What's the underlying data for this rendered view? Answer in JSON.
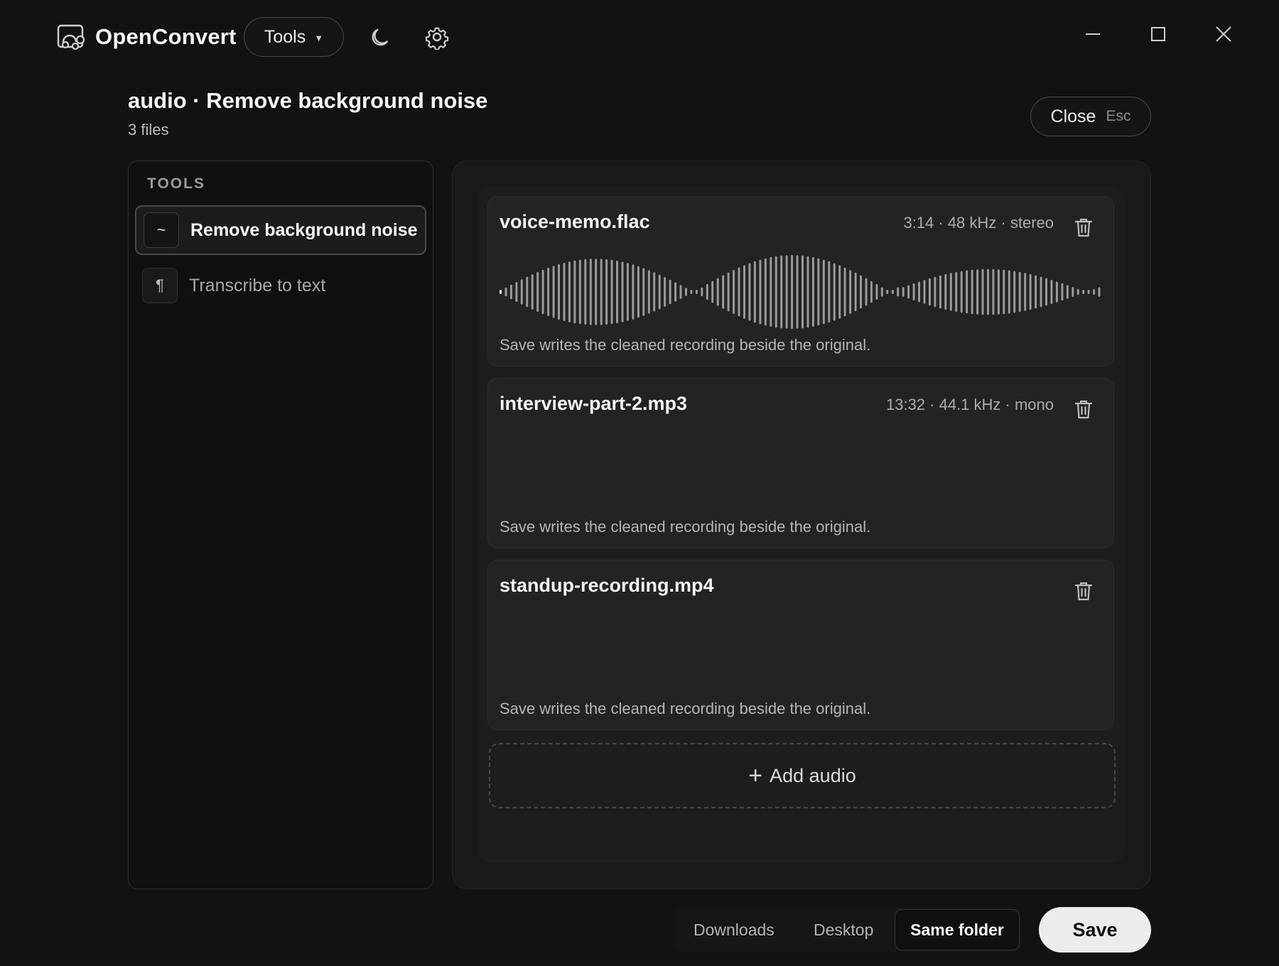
{
  "app": {
    "name": "OpenConvert",
    "tools_label": "Tools",
    "icons": [
      "app-logo-icon",
      "chevron-down-icon",
      "moon-icon",
      "gear-icon",
      "minimize-icon",
      "maximize-icon",
      "close-icon"
    ]
  },
  "header": {
    "title": "audio · Remove background noise",
    "subtitle": "3 files",
    "close_label": "Close",
    "close_shortcut": "Esc"
  },
  "sidebar": {
    "heading": "TOOLS",
    "items": [
      {
        "label": "Remove background noise",
        "icon": "~",
        "icon_name": "wave-icon",
        "active": true
      },
      {
        "label": "Transcribe to text",
        "icon": "¶",
        "icon_name": "pilcrow-icon",
        "active": false
      }
    ]
  },
  "files": [
    {
      "name": "voice-memo.flac",
      "meta": "3:14 · 48 kHz · stereo",
      "note": "Save writes the cleaned recording beside the original.",
      "waveform_shown": true
    },
    {
      "name": "interview-part-2.mp3",
      "meta": "13:32 · 44.1 kHz · mono",
      "note": "Save writes the cleaned recording beside the original.",
      "waveform_shown": false
    },
    {
      "name": "standup-recording.mp4",
      "meta": "",
      "note": "Save writes the cleaned recording beside the original.",
      "waveform_shown": false
    }
  ],
  "add_button": {
    "icon": "+",
    "label": "Add audio"
  },
  "destinations": {
    "options": [
      "Downloads",
      "Desktop",
      "Same folder"
    ],
    "selected": "Same folder"
  },
  "save_label": "Save",
  "colors": {
    "background": "#121212",
    "card": "#232323",
    "waveform": "#9a9a9a",
    "save_button": "#ececec"
  }
}
